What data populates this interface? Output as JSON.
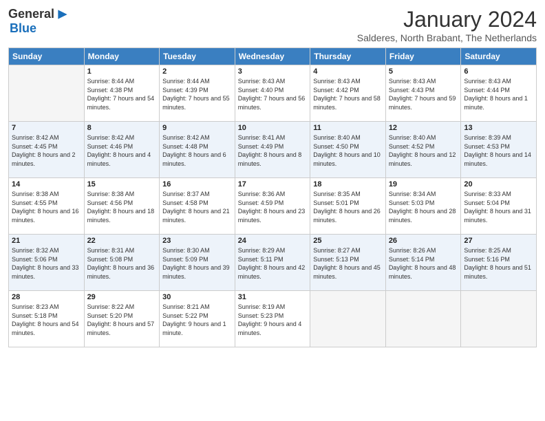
{
  "logo": {
    "general": "General",
    "blue": "Blue"
  },
  "title": "January 2024",
  "subtitle": "Salderes, North Brabant, The Netherlands",
  "days_of_week": [
    "Sunday",
    "Monday",
    "Tuesday",
    "Wednesday",
    "Thursday",
    "Friday",
    "Saturday"
  ],
  "weeks": [
    [
      {
        "day": "",
        "sunrise": "",
        "sunset": "",
        "daylight": "",
        "empty": true
      },
      {
        "day": "1",
        "sunrise": "Sunrise: 8:44 AM",
        "sunset": "Sunset: 4:38 PM",
        "daylight": "Daylight: 7 hours and 54 minutes."
      },
      {
        "day": "2",
        "sunrise": "Sunrise: 8:44 AM",
        "sunset": "Sunset: 4:39 PM",
        "daylight": "Daylight: 7 hours and 55 minutes."
      },
      {
        "day": "3",
        "sunrise": "Sunrise: 8:43 AM",
        "sunset": "Sunset: 4:40 PM",
        "daylight": "Daylight: 7 hours and 56 minutes."
      },
      {
        "day": "4",
        "sunrise": "Sunrise: 8:43 AM",
        "sunset": "Sunset: 4:42 PM",
        "daylight": "Daylight: 7 hours and 58 minutes."
      },
      {
        "day": "5",
        "sunrise": "Sunrise: 8:43 AM",
        "sunset": "Sunset: 4:43 PM",
        "daylight": "Daylight: 7 hours and 59 minutes."
      },
      {
        "day": "6",
        "sunrise": "Sunrise: 8:43 AM",
        "sunset": "Sunset: 4:44 PM",
        "daylight": "Daylight: 8 hours and 1 minute."
      }
    ],
    [
      {
        "day": "7",
        "sunrise": "Sunrise: 8:42 AM",
        "sunset": "Sunset: 4:45 PM",
        "daylight": "Daylight: 8 hours and 2 minutes."
      },
      {
        "day": "8",
        "sunrise": "Sunrise: 8:42 AM",
        "sunset": "Sunset: 4:46 PM",
        "daylight": "Daylight: 8 hours and 4 minutes."
      },
      {
        "day": "9",
        "sunrise": "Sunrise: 8:42 AM",
        "sunset": "Sunset: 4:48 PM",
        "daylight": "Daylight: 8 hours and 6 minutes."
      },
      {
        "day": "10",
        "sunrise": "Sunrise: 8:41 AM",
        "sunset": "Sunset: 4:49 PM",
        "daylight": "Daylight: 8 hours and 8 minutes."
      },
      {
        "day": "11",
        "sunrise": "Sunrise: 8:40 AM",
        "sunset": "Sunset: 4:50 PM",
        "daylight": "Daylight: 8 hours and 10 minutes."
      },
      {
        "day": "12",
        "sunrise": "Sunrise: 8:40 AM",
        "sunset": "Sunset: 4:52 PM",
        "daylight": "Daylight: 8 hours and 12 minutes."
      },
      {
        "day": "13",
        "sunrise": "Sunrise: 8:39 AM",
        "sunset": "Sunset: 4:53 PM",
        "daylight": "Daylight: 8 hours and 14 minutes."
      }
    ],
    [
      {
        "day": "14",
        "sunrise": "Sunrise: 8:38 AM",
        "sunset": "Sunset: 4:55 PM",
        "daylight": "Daylight: 8 hours and 16 minutes."
      },
      {
        "day": "15",
        "sunrise": "Sunrise: 8:38 AM",
        "sunset": "Sunset: 4:56 PM",
        "daylight": "Daylight: 8 hours and 18 minutes."
      },
      {
        "day": "16",
        "sunrise": "Sunrise: 8:37 AM",
        "sunset": "Sunset: 4:58 PM",
        "daylight": "Daylight: 8 hours and 21 minutes."
      },
      {
        "day": "17",
        "sunrise": "Sunrise: 8:36 AM",
        "sunset": "Sunset: 4:59 PM",
        "daylight": "Daylight: 8 hours and 23 minutes."
      },
      {
        "day": "18",
        "sunrise": "Sunrise: 8:35 AM",
        "sunset": "Sunset: 5:01 PM",
        "daylight": "Daylight: 8 hours and 26 minutes."
      },
      {
        "day": "19",
        "sunrise": "Sunrise: 8:34 AM",
        "sunset": "Sunset: 5:03 PM",
        "daylight": "Daylight: 8 hours and 28 minutes."
      },
      {
        "day": "20",
        "sunrise": "Sunrise: 8:33 AM",
        "sunset": "Sunset: 5:04 PM",
        "daylight": "Daylight: 8 hours and 31 minutes."
      }
    ],
    [
      {
        "day": "21",
        "sunrise": "Sunrise: 8:32 AM",
        "sunset": "Sunset: 5:06 PM",
        "daylight": "Daylight: 8 hours and 33 minutes."
      },
      {
        "day": "22",
        "sunrise": "Sunrise: 8:31 AM",
        "sunset": "Sunset: 5:08 PM",
        "daylight": "Daylight: 8 hours and 36 minutes."
      },
      {
        "day": "23",
        "sunrise": "Sunrise: 8:30 AM",
        "sunset": "Sunset: 5:09 PM",
        "daylight": "Daylight: 8 hours and 39 minutes."
      },
      {
        "day": "24",
        "sunrise": "Sunrise: 8:29 AM",
        "sunset": "Sunset: 5:11 PM",
        "daylight": "Daylight: 8 hours and 42 minutes."
      },
      {
        "day": "25",
        "sunrise": "Sunrise: 8:27 AM",
        "sunset": "Sunset: 5:13 PM",
        "daylight": "Daylight: 8 hours and 45 minutes."
      },
      {
        "day": "26",
        "sunrise": "Sunrise: 8:26 AM",
        "sunset": "Sunset: 5:14 PM",
        "daylight": "Daylight: 8 hours and 48 minutes."
      },
      {
        "day": "27",
        "sunrise": "Sunrise: 8:25 AM",
        "sunset": "Sunset: 5:16 PM",
        "daylight": "Daylight: 8 hours and 51 minutes."
      }
    ],
    [
      {
        "day": "28",
        "sunrise": "Sunrise: 8:23 AM",
        "sunset": "Sunset: 5:18 PM",
        "daylight": "Daylight: 8 hours and 54 minutes."
      },
      {
        "day": "29",
        "sunrise": "Sunrise: 8:22 AM",
        "sunset": "Sunset: 5:20 PM",
        "daylight": "Daylight: 8 hours and 57 minutes."
      },
      {
        "day": "30",
        "sunrise": "Sunrise: 8:21 AM",
        "sunset": "Sunset: 5:22 PM",
        "daylight": "Daylight: 9 hours and 1 minute."
      },
      {
        "day": "31",
        "sunrise": "Sunrise: 8:19 AM",
        "sunset": "Sunset: 5:23 PM",
        "daylight": "Daylight: 9 hours and 4 minutes."
      },
      {
        "day": "",
        "sunrise": "",
        "sunset": "",
        "daylight": "",
        "empty": true
      },
      {
        "day": "",
        "sunrise": "",
        "sunset": "",
        "daylight": "",
        "empty": true
      },
      {
        "day": "",
        "sunrise": "",
        "sunset": "",
        "daylight": "",
        "empty": true
      }
    ]
  ]
}
